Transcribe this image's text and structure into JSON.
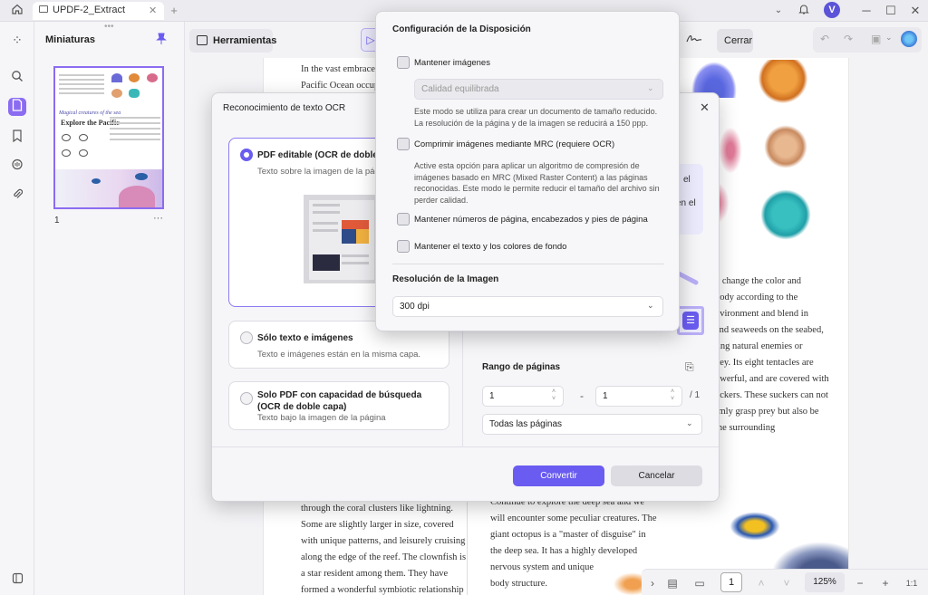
{
  "titlebar": {
    "tab_label": "UPDF-2_Extract",
    "avatar_letter": "V"
  },
  "thumbnails": {
    "title": "Miniaturas",
    "page_number": "1",
    "thumb_caption": "Magical creatures of the sea",
    "thumb_heading": "Explore the Pacific"
  },
  "toolbar": {
    "tools_label": "Herramientas",
    "close_label": "Cerrar"
  },
  "document": {
    "top_lines": [
      "In the vast embrace of",
      "Pacific Ocean occupi"
    ],
    "right_lines": [
      "y change the color and",
      "body according to the",
      "nvironment and blend in",
      "and seaweeds on the seabed,",
      "ling natural enemies or",
      "key. Its eight tentacles are",
      "owerful, and are covered with",
      "uckers. These suckers can not",
      "rmly grasp prey but also be",
      "the surrounding"
    ],
    "bottom_left_lines": [
      "through the coral clusters like lightning.",
      "Some are slightly larger in size, covered",
      "with unique patterns, and leisurely cruising",
      "along the edge of the reef. The clownfish is",
      "a star resident among them. They have",
      "formed a wonderful symbiotic relationship"
    ],
    "bottom_right_lines": [
      "Continue to explore the deep sea and we",
      "will encounter some peculiar creatures. The",
      "giant octopus is a \"master of disguise\" in",
      "the deep sea. It has a highly developed",
      "nervous system and unique",
      "body structure."
    ],
    "partial_right": [
      "el",
      "en el"
    ]
  },
  "ocr_dialog": {
    "title": "Reconocimiento de texto OCR",
    "options": [
      {
        "title": "PDF editable (OCR de doble capa)",
        "sub": "Texto sobre la imagen de la página"
      },
      {
        "title": "Sólo texto e imágenes",
        "sub": "Texto e imágenes están en la misma capa."
      },
      {
        "title": "Solo PDF con capacidad de búsqueda (OCR de doble capa)",
        "sub": "Texto bajo la imagen de la página"
      }
    ],
    "range_label": "Rango de páginas",
    "from_page": "1",
    "to_page": "1",
    "range_total": "/ 1",
    "range_dash": "-",
    "pages_select": "Todas las páginas",
    "convert_label": "Convertir",
    "cancel_label": "Cancelar"
  },
  "layout_popup": {
    "title": "Configuración de la Disposición",
    "keep_images": "Mantener imágenes",
    "quality_placeholder": "Calidad equilibrada",
    "keep_images_desc": "Este modo se utiliza para crear un documento de tamaño reducido. La resolución de la página y de la imagen se reducirá a 150 ppp.",
    "compress_mrc": "Comprimir imágenes mediante MRC (requiere OCR)",
    "compress_desc": "Active esta opción para aplicar un algoritmo de compresión de imágenes basado en MRC (Mixed Raster Content) a las páginas reconocidas. Este modo le permite reducir el tamaño del archivo sin perder calidad.",
    "keep_numbers": "Mantener números de página, encabezados y pies de página",
    "keep_colors": "Mantener el texto y los colores de fondo",
    "resolution_label": "Resolución de la Imagen",
    "resolution_value": "300 dpi"
  },
  "statusbar": {
    "page_value": "1",
    "zoom": "125%"
  },
  "colors": {
    "accent": "#6a5cf0",
    "highlight": "#8b6cf1"
  }
}
